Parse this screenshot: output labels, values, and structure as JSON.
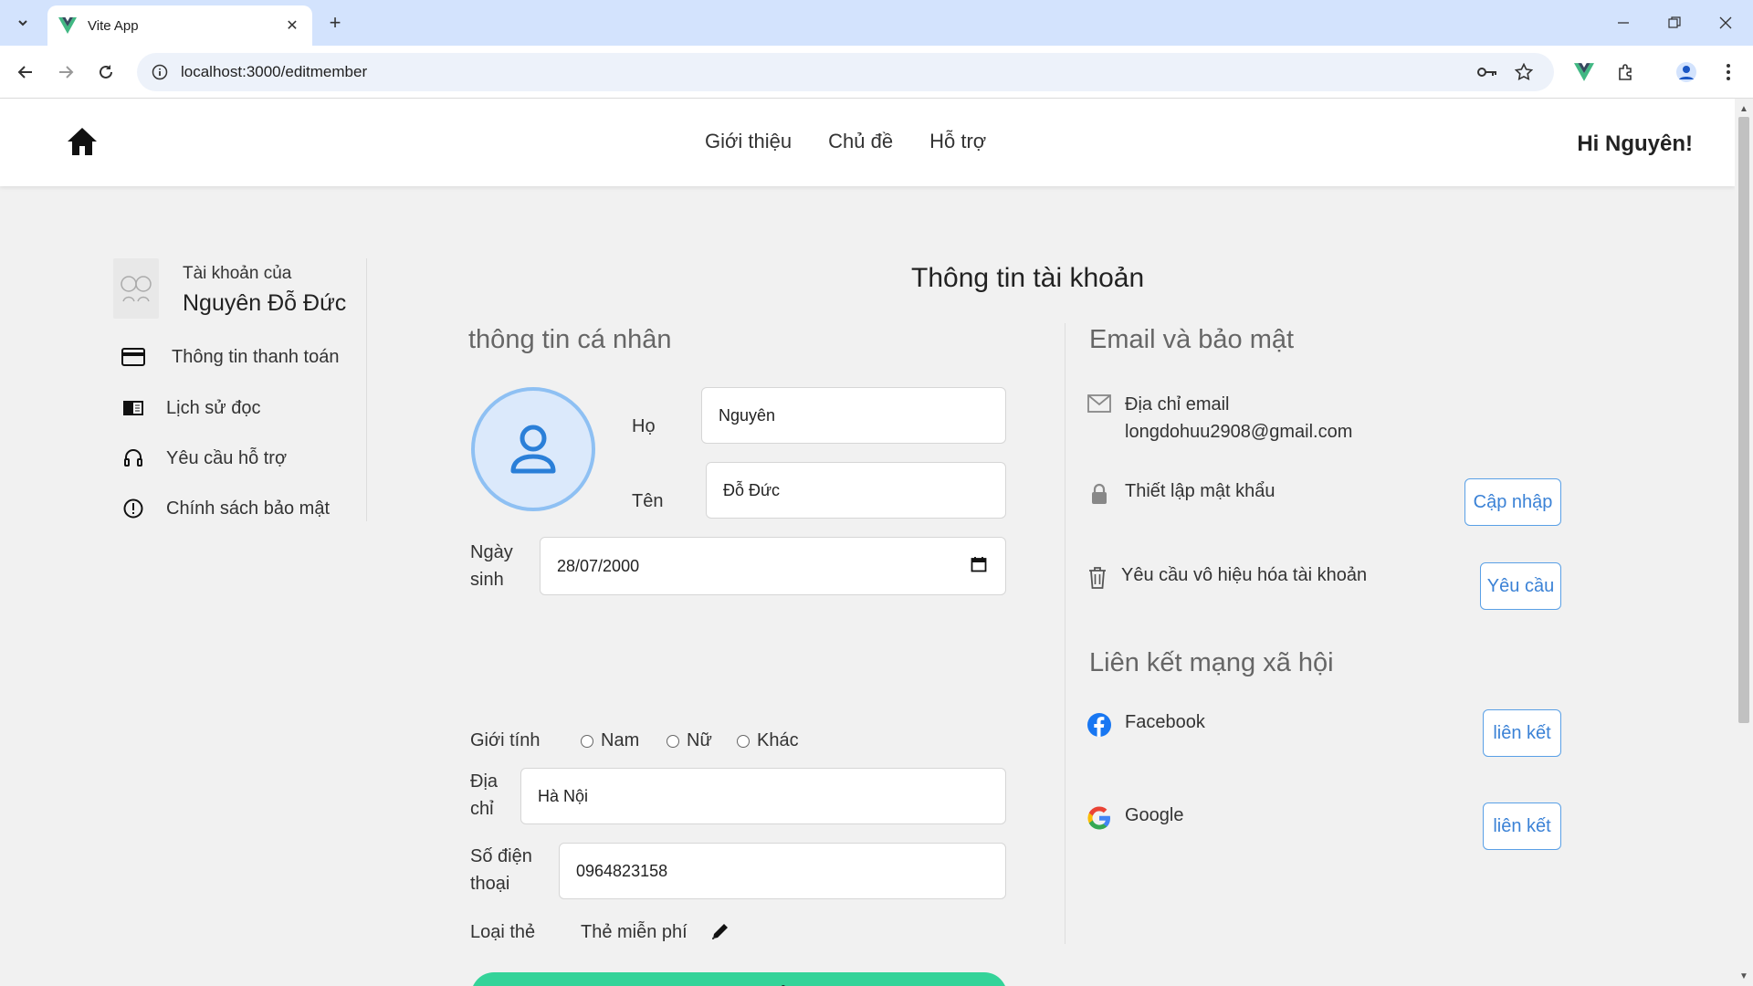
{
  "browser": {
    "tab_title": "Vite App",
    "url": "localhost:3000/editmember"
  },
  "header": {
    "nav": [
      "Giới thiệu",
      "Chủ đề",
      "Hỗ trợ"
    ],
    "greeting": "Hi Nguyên!"
  },
  "sidebar": {
    "account_label": "Tài khoản của",
    "account_name": "Nguyên Đỗ Đức",
    "items": [
      {
        "label": "Thông tin thanh toán",
        "icon": "credit-card-icon"
      },
      {
        "label": "Lịch sử đọc",
        "icon": "book-icon"
      },
      {
        "label": "Yêu cầu hỗ trợ",
        "icon": "headset-icon"
      },
      {
        "label": "Chính sách bảo mật",
        "icon": "info-circle-icon"
      }
    ]
  },
  "main": {
    "title": "Thông tin tài khoản",
    "personal_heading": "thông tin cá nhân",
    "fields": {
      "last_name_label": "Họ",
      "last_name_value": "Nguyên",
      "first_name_label": "Tên",
      "first_name_value": "Đỗ Đức",
      "dob_label_1": "Ngày",
      "dob_label_2": "sinh",
      "dob_value": "28/07/2000",
      "gender_label": "Giới tính",
      "gender_options": [
        "Nam",
        "Nữ",
        "Khác"
      ],
      "address_label_1": "Địa",
      "address_label_2": "chỉ",
      "address_value": "Hà Nội",
      "phone_label_1": "Số điện",
      "phone_label_2": "thoại",
      "phone_value": "0964823158",
      "card_label": "Loại thẻ",
      "card_value": "Thẻ miễn phí"
    },
    "save_label": "Lưu thay đổi"
  },
  "security": {
    "heading": "Email và bảo mật",
    "email_label": "Địa chỉ email",
    "email_value": "longdohuu2908@gmail.com",
    "password_label": "Thiết lập mật khẩu",
    "password_button": "Cập nhập",
    "disable_label": "Yêu cầu vô hiệu hóa tài khoản",
    "disable_button": "Yêu cầu"
  },
  "social": {
    "heading": "Liên kết mạng xã hội",
    "facebook_label": "Facebook",
    "google_label": "Google",
    "link_button": "liên kết"
  },
  "colors": {
    "save_button": "#34d399",
    "outline_button": "#3b82d6",
    "avatar_border": "#8ec0f3",
    "tabbar": "#d3e3fd"
  }
}
